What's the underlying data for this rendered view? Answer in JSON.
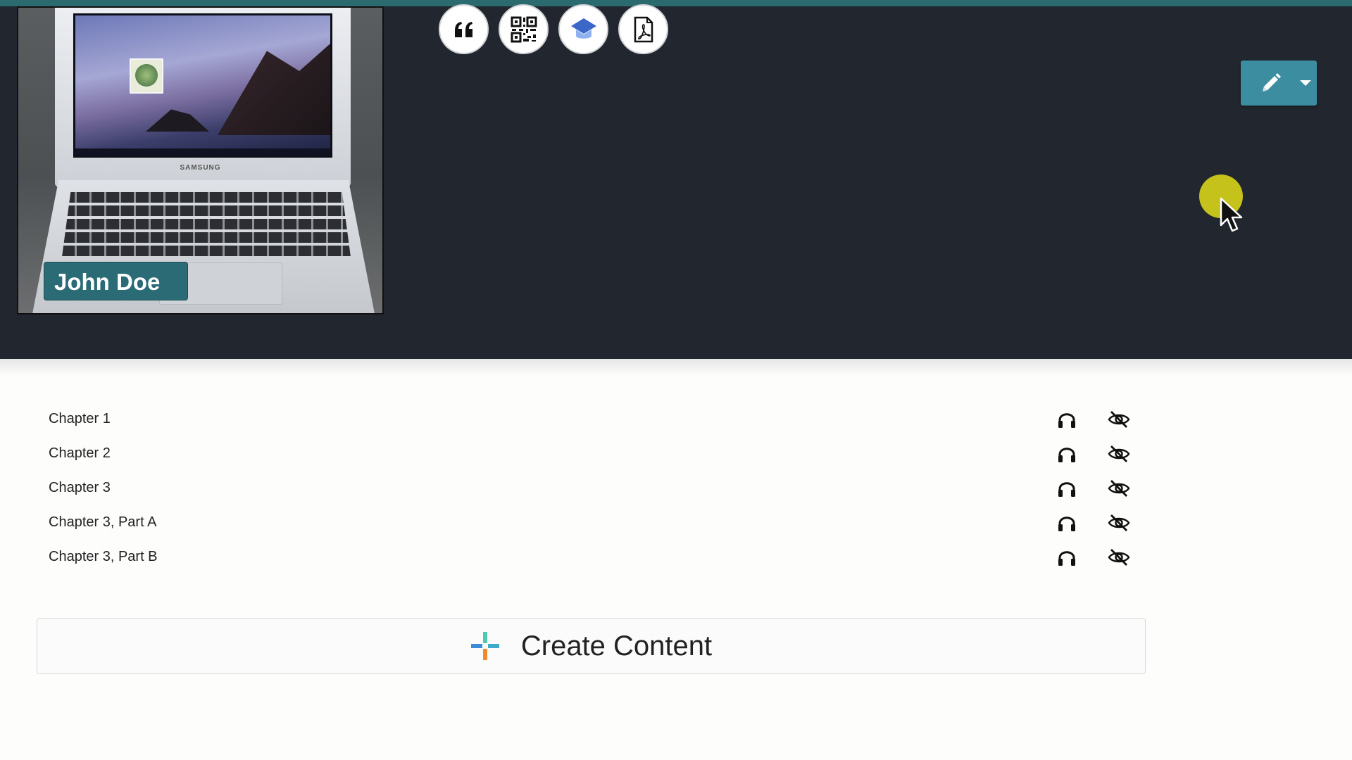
{
  "hero": {
    "cover_image": {
      "alt": "Samsung Chromebook laptop",
      "brand_text": "SAMSUNG"
    },
    "author_name": "John Doe"
  },
  "toolbar": {
    "buttons": [
      {
        "id": "cite",
        "icon": "quote-icon"
      },
      {
        "id": "qr",
        "icon": "qr-code-icon"
      },
      {
        "id": "classroom",
        "icon": "graduation-cap-icon"
      },
      {
        "id": "pdf",
        "icon": "pdf-file-icon"
      }
    ]
  },
  "edit_menu": {
    "icon": "pencil-icon",
    "dropdown_icon": "caret-down-icon"
  },
  "chapters": [
    {
      "title": "Chapter 1"
    },
    {
      "title": "Chapter 2"
    },
    {
      "title": "Chapter 3"
    },
    {
      "title": "Chapter 3, Part A"
    },
    {
      "title": "Chapter 3, Part B"
    }
  ],
  "create_content": {
    "label": "Create Content",
    "icon": "plus-colorful-icon"
  },
  "colors": {
    "accent": "#3c8da0",
    "header_bg": "#22262f",
    "top_bar": "#2b6b70",
    "name_tag": "#2b6b75",
    "cursor_highlight": "#d4d01a"
  }
}
